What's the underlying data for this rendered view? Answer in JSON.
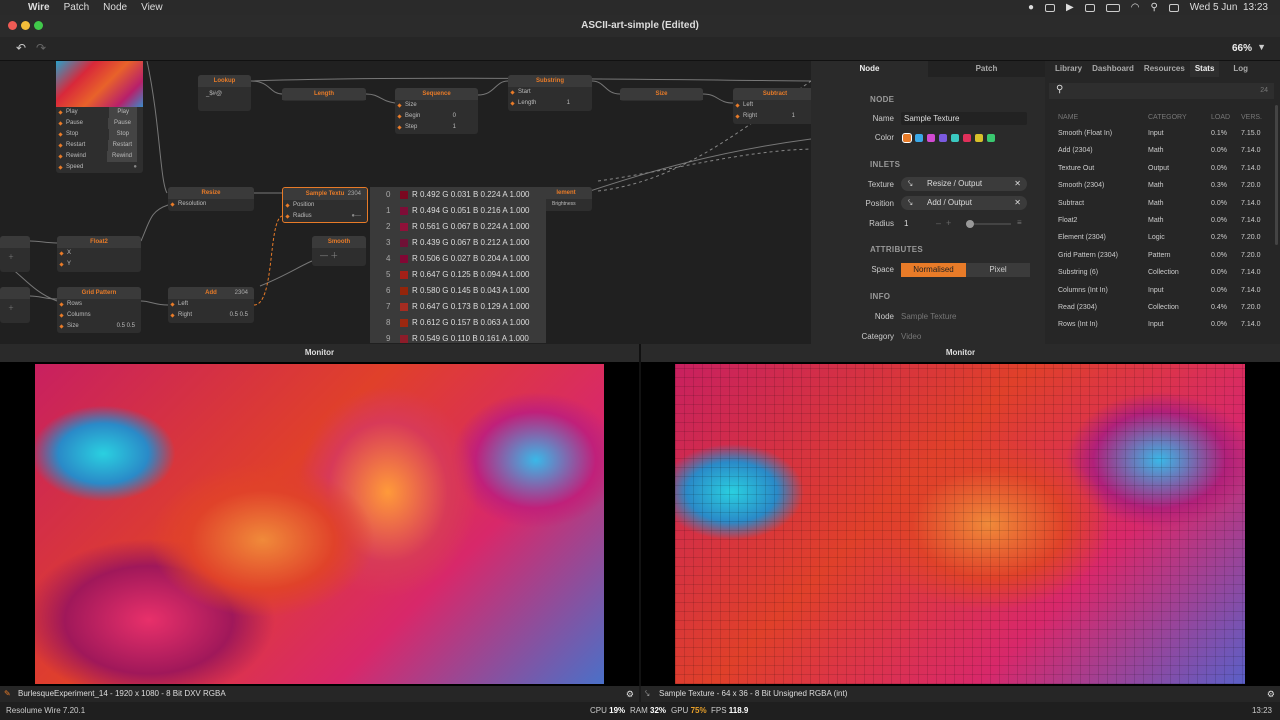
{
  "menubar": {
    "app": "Wire",
    "items": [
      "Patch",
      "Node",
      "View"
    ],
    "date": "Wed 5 Jun",
    "time": "13:23"
  },
  "window": {
    "title": "ASCII-art-simple (Edited)"
  },
  "toolbar": {
    "zoom": "66%"
  },
  "nodes": {
    "player": {
      "rows": [
        [
          "Play",
          "Play"
        ],
        [
          "Pause",
          "Pause"
        ],
        [
          "Stop",
          "Stop"
        ],
        [
          "Restart",
          "Restart"
        ],
        [
          "Rewind",
          "Rewind"
        ],
        [
          "Speed",
          ""
        ]
      ]
    },
    "lookup": {
      "title": "Lookup",
      "value": "_$#@"
    },
    "length": {
      "title": "Length"
    },
    "sequence": {
      "title": "Sequence",
      "rows": [
        [
          "Size",
          ""
        ],
        [
          "Begin",
          "0"
        ],
        [
          "Step",
          "1"
        ]
      ]
    },
    "substring": {
      "title": "Substring",
      "rows": [
        [
          "Start",
          ""
        ],
        [
          "Length",
          "1"
        ]
      ]
    },
    "size": {
      "title": "Size"
    },
    "subtract": {
      "title": "Subtract",
      "rows": [
        [
          "Left",
          ""
        ],
        [
          "Right",
          "1"
        ]
      ]
    },
    "resize": {
      "title": "Resize",
      "rows": [
        [
          "Resolution",
          ""
        ]
      ]
    },
    "sample_texture": {
      "title": "Sample Textu",
      "badge": "2304",
      "rows": [
        [
          "Position",
          ""
        ],
        [
          "Radius",
          ""
        ]
      ]
    },
    "element": {
      "title": "lement",
      "value": "Brightness"
    },
    "float2": {
      "title": "Float2",
      "rows": [
        [
          "X",
          ""
        ],
        [
          "Y",
          ""
        ]
      ]
    },
    "smooth": {
      "title": "Smooth"
    },
    "grid_pattern": {
      "title": "Grid Pattern",
      "rows": [
        [
          "Rows",
          ""
        ],
        [
          "Columns",
          ""
        ],
        [
          "Size",
          "0.5    0.5"
        ]
      ]
    },
    "add": {
      "title": "Add",
      "badge": "2304",
      "rows": [
        [
          "Left",
          ""
        ],
        [
          "Right",
          "0.5    0.5"
        ]
      ]
    }
  },
  "datatable": [
    {
      "i": "0",
      "color": "#7a0820",
      "r": "0.492",
      "g": "0.031",
      "b": "0.224",
      "a": "1.000"
    },
    {
      "i": "1",
      "color": "#7e0d37",
      "r": "0.494",
      "g": "0.051",
      "b": "0.216",
      "a": "1.000"
    },
    {
      "i": "2",
      "color": "#8f1139",
      "r": "0.561",
      "g": "0.067",
      "b": "0.224",
      "a": "1.000"
    },
    {
      "i": "3",
      "color": "#701136",
      "r": "0.439",
      "g": "0.067",
      "b": "0.212",
      "a": "1.000"
    },
    {
      "i": "4",
      "color": "#810734",
      "r": "0.506",
      "g": "0.027",
      "b": "0.204",
      "a": "1.000"
    },
    {
      "i": "5",
      "color": "#a52018",
      "r": "0.647",
      "g": "0.125",
      "b": "0.094",
      "a": "1.000"
    },
    {
      "i": "6",
      "color": "#94250b",
      "r": "0.580",
      "g": "0.145",
      "b": "0.043",
      "a": "1.000"
    },
    {
      "i": "7",
      "color": "#a52c21",
      "r": "0.647",
      "g": "0.173",
      "b": "0.129",
      "a": "1.000"
    },
    {
      "i": "8",
      "color": "#9c2810",
      "r": "0.612",
      "g": "0.157",
      "b": "0.063",
      "a": "1.000"
    },
    {
      "i": "9",
      "color": "#8c1c29",
      "r": "0.549",
      "g": "0.110",
      "b": "0.161",
      "a": "1.000"
    }
  ],
  "inspector": {
    "tabs": [
      "Node",
      "Patch"
    ],
    "sections": {
      "node": "NODE",
      "inlets": "INLETS",
      "attributes": "ATTRIBUTES",
      "info": "INFO"
    },
    "name_label": "Name",
    "name_value": "Sample Texture",
    "color_label": "Color",
    "colors": [
      "#e87b28",
      "#3aa8e8",
      "#d24ad2",
      "#7a5ae0",
      "#3ac8c0",
      "#e0305a",
      "#d8c02a",
      "#3ac870"
    ],
    "texture_label": "Texture",
    "texture_value": "Resize / Output",
    "position_label": "Position",
    "position_value": "Add / Output",
    "radius_label": "Radius",
    "radius_value": "1",
    "space_label": "Space",
    "space_opts": [
      "Normalised",
      "Pixel"
    ],
    "info_node_label": "Node",
    "info_node_value": "Sample Texture",
    "info_cat_label": "Category",
    "info_cat_value": "Video"
  },
  "stats": {
    "tabs": [
      "Library",
      "Dashboard",
      "Resources",
      "Stats",
      "Log"
    ],
    "search_count": "24",
    "headers": [
      "NAME",
      "CATEGORY",
      "LOAD",
      "VERS."
    ],
    "rows": [
      [
        "Smooth (Float In)",
        "Input",
        "0.1%",
        "7.15.0"
      ],
      [
        "Add (2304)",
        "Math",
        "0.0%",
        "7.14.0"
      ],
      [
        "Texture Out",
        "Output",
        "0.0%",
        "7.14.0"
      ],
      [
        "Smooth (2304)",
        "Math",
        "0.3%",
        "7.20.0"
      ],
      [
        "Subtract",
        "Math",
        "0.0%",
        "7.14.0"
      ],
      [
        "Float2",
        "Math",
        "0.0%",
        "7.14.0"
      ],
      [
        "Element (2304)",
        "Logic",
        "0.2%",
        "7.20.0"
      ],
      [
        "Grid Pattern (2304)",
        "Pattern",
        "0.0%",
        "7.20.0"
      ],
      [
        "Substring (6)",
        "Collection",
        "0.0%",
        "7.14.0"
      ],
      [
        "Columns (Int In)",
        "Input",
        "0.0%",
        "7.14.0"
      ],
      [
        "Read (2304)",
        "Collection",
        "0.4%",
        "7.20.0"
      ],
      [
        "Rows (Int In)",
        "Input",
        "0.0%",
        "7.14.0"
      ]
    ]
  },
  "monitors": {
    "left": {
      "title": "Monitor",
      "info": "BurlesqueExperiment_14 - 1920 x 1080 - 8 Bit DXV RGBA"
    },
    "right": {
      "title": "Monitor",
      "info": "Sample Texture - 64 x 36 - 8 Bit Unsigned RGBA (int)"
    }
  },
  "status": {
    "version": "Resolume Wire 7.20.1",
    "cpu_label": "CPU",
    "cpu": "19%",
    "ram_label": "RAM",
    "ram": "32%",
    "gpu_label": "GPU",
    "gpu": "75%",
    "fps_label": "FPS",
    "fps": "118.9",
    "time": "13:23"
  },
  "colors": {
    "accent": "#e87b28",
    "bg": "#1c1c1c"
  }
}
